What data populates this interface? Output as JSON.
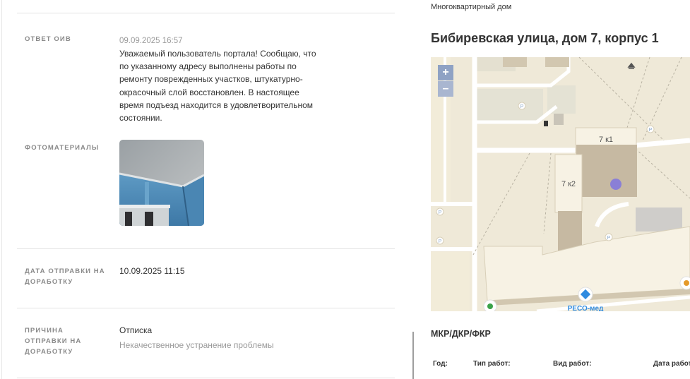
{
  "appeal": {
    "response": {
      "label": "ОТВЕТ ОИВ",
      "date": "09.09.2025 16:57",
      "lines": [
        "Уважаемый пользователь портала! Сообщаю, что",
        "по указанному адресу выполнены работы по",
        "ремонту поврежденных участков, штукатурно-",
        "окрасочный слой восстановлен. В настоящее",
        "время подъезд находится в удовлетворительном",
        "состоянии."
      ]
    },
    "photos": {
      "label": "ФОТОМАТЕРИАЛЫ"
    },
    "rework_date": {
      "label_lines": [
        "ДАТА ОТПРАВКИ НА",
        "ДОРАБОТКУ"
      ],
      "value": "10.09.2025 11:15"
    },
    "rework_reason": {
      "label_lines": [
        "ПРИЧИНА",
        "ОТПРАВКИ НА",
        "ДОРАБОТКУ"
      ],
      "value": "Отписка",
      "detail": "Некачественное устранение проблемы"
    }
  },
  "building": {
    "type": "Многоквартирный дом",
    "address": "Бибиревская улица, дом 7, корпус 1"
  },
  "map": {
    "zoom_in": "+",
    "zoom_out": "–",
    "labels": {
      "building_k1": "7 к1",
      "building_k2": "7 к2",
      "poi_reso": "РЕСО-мед",
      "parking": "P"
    },
    "colors": {
      "land": "#efe9d8",
      "road": "#ffffff",
      "building": "#d2c7b0",
      "selected_building": "#c6b9a2",
      "marker": "#8a7fd6",
      "accent_blue": "#2f8be0"
    }
  },
  "works": {
    "title": "МКР/ДКР/ФКР",
    "columns": [
      "Год:",
      "Тип работ:",
      "Вид работ:",
      "Дата работ"
    ]
  }
}
